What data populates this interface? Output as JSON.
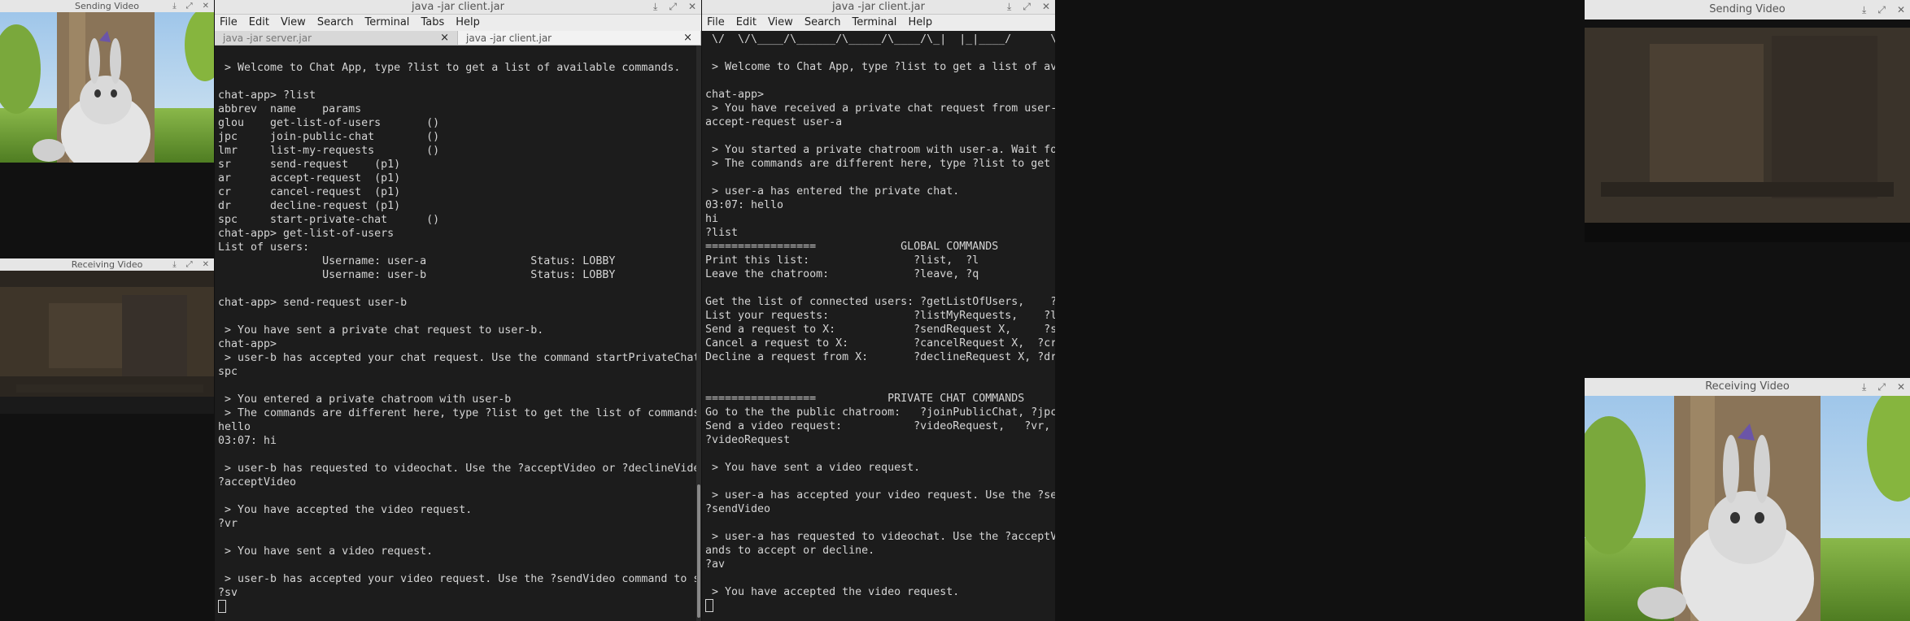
{
  "windows": {
    "send_left": {
      "title": "Sending Video"
    },
    "recv_left": {
      "title": "Receiving Video"
    },
    "send_right": {
      "title": "Sending Video"
    },
    "recv_right": {
      "title": "Receiving Video"
    },
    "term_left": {
      "title": "java -jar client.jar",
      "menu": [
        "File",
        "Edit",
        "View",
        "Search",
        "Terminal",
        "Tabs",
        "Help"
      ],
      "tabs": [
        {
          "label": "java -jar server.jar",
          "close": "×"
        },
        {
          "label": "java -jar client.jar",
          "close": "×"
        }
      ],
      "output": "\n > Welcome to Chat App, type ?list to get a list of available commands.\n\nchat-app> ?list\nabbrev  name    params\nglou    get-list-of-users       ()\njpc     join-public-chat        ()\nlmr     list-my-requests        ()\nsr      send-request    (p1)\nar      accept-request  (p1)\ncr      cancel-request  (p1)\ndr      decline-request (p1)\nspc     start-private-chat      ()\nchat-app> get-list-of-users\nList of users:\n                Username: user-a                Status: LOBBY\n                Username: user-b                Status: LOBBY\n\nchat-app> send-request user-b\n\n > You have sent a private chat request to user-b.\nchat-app>\n > user-b has accepted your chat request. Use the command startPrivateChat to start chatting!\nspc\n\n > You entered a private chatroom with user-b\n > The commands are different here, type ?list to get the list of commands.\nhello\n03:07: hi\n\n > user-b has requested to videochat. Use the ?acceptVideo or ?declineVideo commands to accept or decline.\n?acceptVideo\n\n > You have accepted the video request.\n?vr\n\n > You have sent a video request.\n\n > user-b has accepted your video request. Use the ?sendVideo command to start.\n?sv"
    },
    "term_right": {
      "title": "java -jar client.jar",
      "menu": [
        "File",
        "Edit",
        "View",
        "Search",
        "Terminal",
        "Help"
      ],
      "output": " \\/  \\/\\____/\\______/\\_____/\\____/\\_|  |_|____/      \\_/  \\___/      \\____|_| |_|_|\n\n > Welcome to Chat App, type ?list to get a list of available commands.\n\nchat-app>\n > You have received a private chat request from user-a.\naccept-request user-a\n\n > You started a private chatroom with user-a. Wait for them to arrive.\n > The commands are different here, type ?list to get the list of commands.\n\n > user-a has entered the private chat.\n03:07: hello\nhi\n?list\n=================             GLOBAL COMMANDS             ==================\nPrint this list:                ?list,  ?l\nLeave the chatroom:             ?leave, ?q\n\nGet the list of connected users: ?getListOfUsers,    ?glou\nList your requests:             ?listMyRequests,    ?lmr\nSend a request to X:            ?sendRequest X,     ?sr X\nCancel a request to X:          ?cancelRequest X,  ?cr X\nDecline a request from X:       ?declineRequest X, ?dr X\n\n\n=================           PRIVATE CHAT COMMANDS           ==================\nGo to the the public chatroom:   ?joinPublicChat, ?jpc\nSend a video request:           ?videoRequest,   ?vr, ?sendVideoRequest, ?svr\n?videoRequest\n\n > You have sent a video request.\n\n > user-a has accepted your video request. Use the ?sendVideo command to start.\n?sendVideo\n\n > user-a has requested to videochat. Use the ?acceptVideo or ?declineVideo comm\nands to accept or decline.\n?av\n\n > You have accepted the video request."
    }
  },
  "icons": {
    "minimize": "download-arrow-icon",
    "maximize": "expand-arrows-icon",
    "close": "close-icon"
  },
  "colors": {
    "terminal_bg": "#1c1c1c",
    "terminal_fg": "#d4d4d4",
    "titlebar_bg": "#e6e6e6"
  }
}
